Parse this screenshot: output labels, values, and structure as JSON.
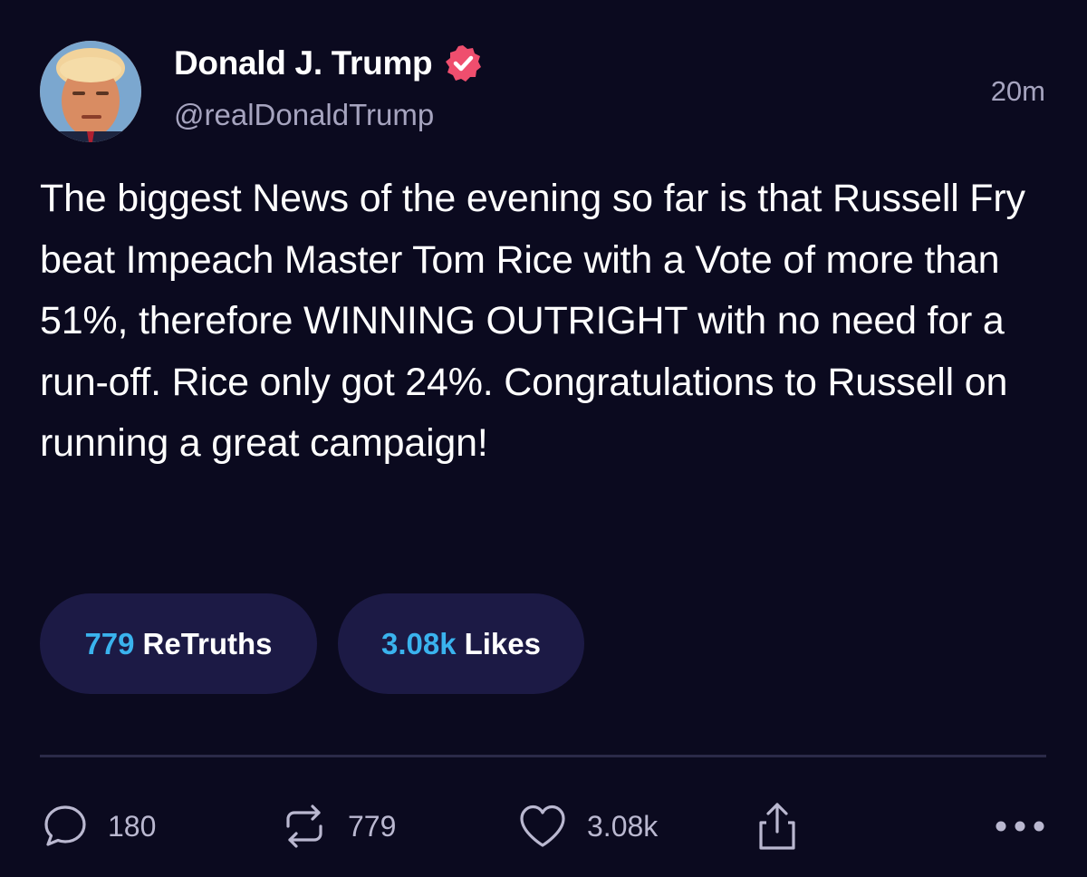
{
  "author": {
    "display_name": "Donald J. Trump",
    "handle": "@realDonaldTrump",
    "verified": true,
    "verified_badge_color": "#ef4e6e"
  },
  "timestamp": "20m",
  "post": {
    "text": "The biggest News of the evening so far is that Russell Fry beat Impeach Master Tom Rice with a Vote of more than 51%, therefore WINNING OUTRIGHT with no need for a run-off. Rice only got 24%. Congratulations to Russell on running a great campaign!"
  },
  "stats": {
    "retruths": {
      "count": "779",
      "label": "ReTruths"
    },
    "likes": {
      "count": "3.08k",
      "label": "Likes"
    }
  },
  "actions": {
    "reply": {
      "icon": "reply-icon",
      "count": "180"
    },
    "retruth": {
      "icon": "retruth-icon",
      "count": "779"
    },
    "like": {
      "icon": "heart-icon",
      "count": "3.08k"
    },
    "share": {
      "icon": "share-icon"
    },
    "more": {
      "icon": "more-icon"
    }
  },
  "colors": {
    "background": "#0b0a1f",
    "accent": "#3ab3ee",
    "pill": "#1c1a45",
    "muted_text": "#a6a4bf"
  }
}
